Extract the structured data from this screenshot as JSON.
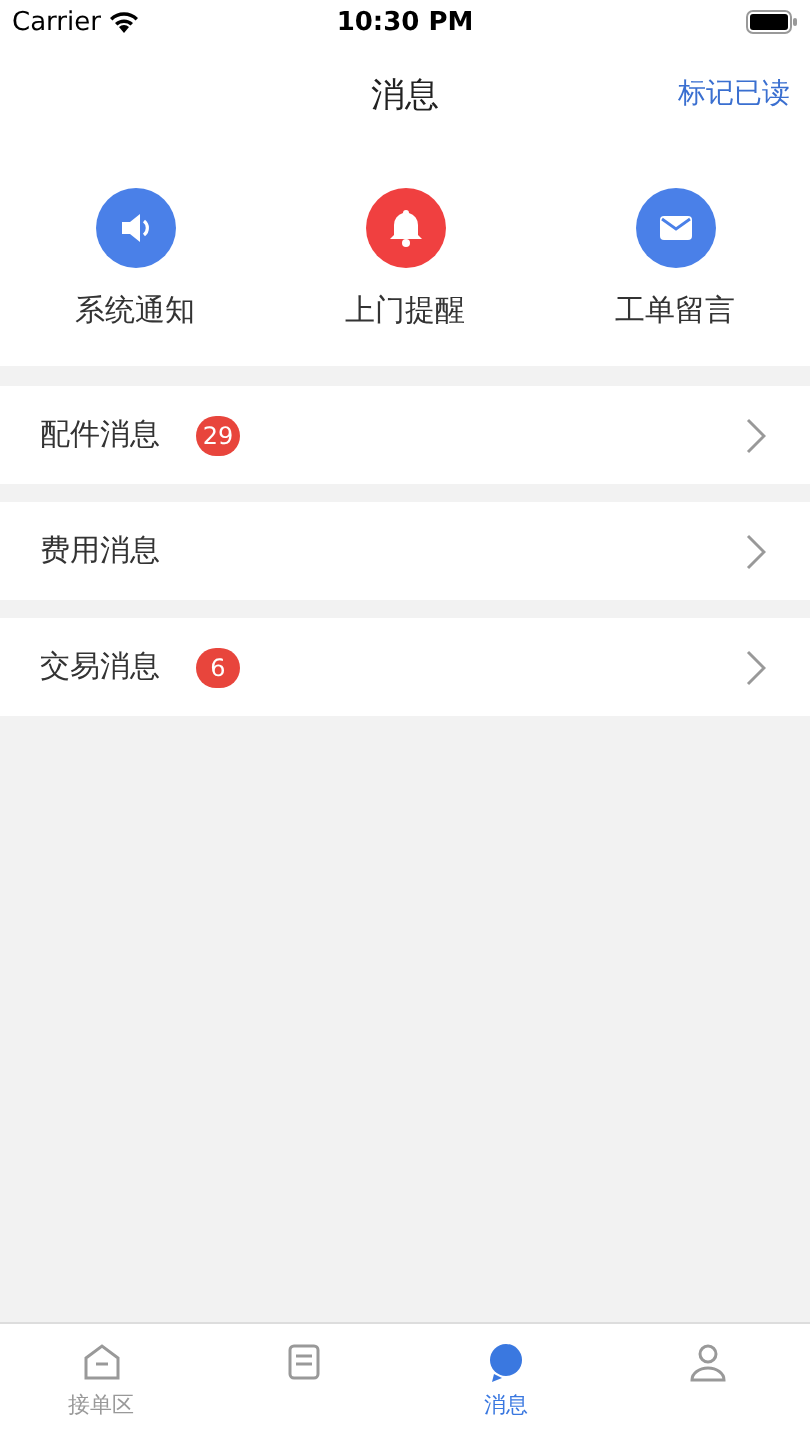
{
  "status_bar": {
    "carrier": "Carrier",
    "time": "10:30 PM"
  },
  "nav": {
    "title": "消息",
    "action": "标记已读"
  },
  "shortcuts": [
    {
      "label": "系统通知",
      "kind": "speaker",
      "color": "#4a80e8"
    },
    {
      "label": "上门提醒",
      "kind": "bell",
      "color": "#f04040"
    },
    {
      "label": "工单留言",
      "kind": "mail",
      "color": "#4a80e8"
    }
  ],
  "rows": [
    {
      "label": "配件消息",
      "badge": "29"
    },
    {
      "label": "费用消息"
    },
    {
      "label": "交易消息",
      "badge": "6"
    }
  ],
  "tabs": [
    {
      "label": "接单区",
      "kind": "home",
      "selected": false
    },
    {
      "kind": "list",
      "selected": false
    },
    {
      "label": "消息",
      "kind": "message",
      "selected": true
    },
    {
      "kind": "user",
      "selected": false
    }
  ]
}
